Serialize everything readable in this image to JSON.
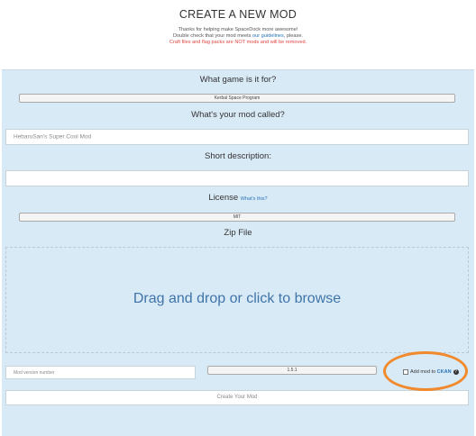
{
  "header": {
    "title": "CREATE A NEW MOD",
    "line1": "Thanks for helping make SpaceDock more awesome!",
    "line2_prefix": "Double check that your mod meets ",
    "line2_link": "our guidelines",
    "line2_suffix": ", please.",
    "line3": "Craft files and flag packs are NOT mods and will be removed."
  },
  "form": {
    "game_label": "What game is it for?",
    "game_value": "Kerbal Space Program",
    "name_label": "What's your mod called?",
    "name_placeholder": "HebaruSan's Super Cool Mod",
    "description_label": "Short description:",
    "description_value": "",
    "license_label": "License",
    "license_help_link": "What's this?",
    "license_value": "MIT",
    "zip_label": "Zip File",
    "dropzone_text": "Drag and drop or click to browse",
    "version_placeholder": "Mod version number",
    "game_version_value": "1.5.1",
    "ckan_prefix": "Add mod to ",
    "ckan_link": "CKAN",
    "ckan_help_icon": "?",
    "submit_label": "Create Your Mod"
  },
  "colors": {
    "panel": "#d9eaf7",
    "link": "#2a73b8",
    "warning": "#e0463f",
    "annotation": "#f18a2d"
  }
}
